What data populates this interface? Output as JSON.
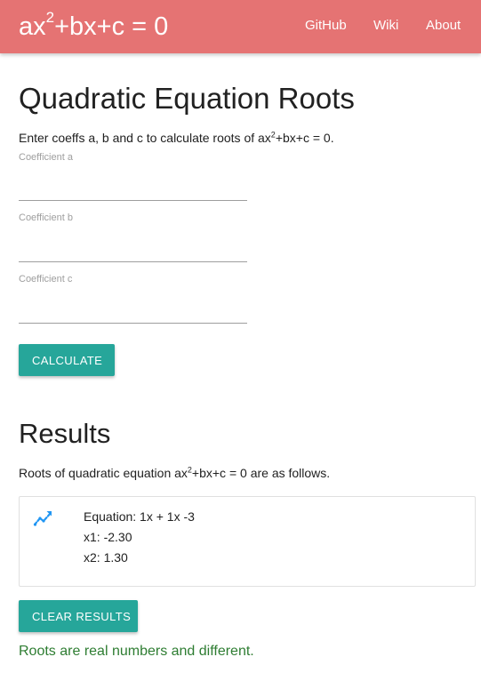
{
  "navbar": {
    "brand_prefix": "ax",
    "brand_exp": "2",
    "brand_suffix": "+bx+c = 0",
    "links": [
      "GitHub",
      "Wiki",
      "About"
    ],
    "color": "#e57373"
  },
  "main": {
    "title": "Quadratic Equation Roots",
    "intro_prefix": "Enter coeffs a, b and c to calculate roots of ax",
    "intro_exp": "2",
    "intro_suffix": "+bx+c = 0.",
    "fields": [
      {
        "label": "Coefficient a",
        "value": ""
      },
      {
        "label": "Coefficient b",
        "value": ""
      },
      {
        "label": "Coefficient c",
        "value": ""
      }
    ],
    "calculate_label": "CALCULATE"
  },
  "results": {
    "title": "Results",
    "intro_prefix": "Roots of quadratic equation ax",
    "intro_exp": "2",
    "intro_suffix": "+bx+c = 0 are as follows.",
    "card": {
      "icon": "trending-up-icon",
      "equation": "Equation: 1x + 1x -3",
      "x1": "x1: -2.30",
      "x2": "x2: 1.30"
    },
    "clear_label": "CLEAR RESULTS",
    "status": "Roots are real numbers and different.",
    "status_color": "#2e7d32"
  },
  "accent": "#26a69a"
}
